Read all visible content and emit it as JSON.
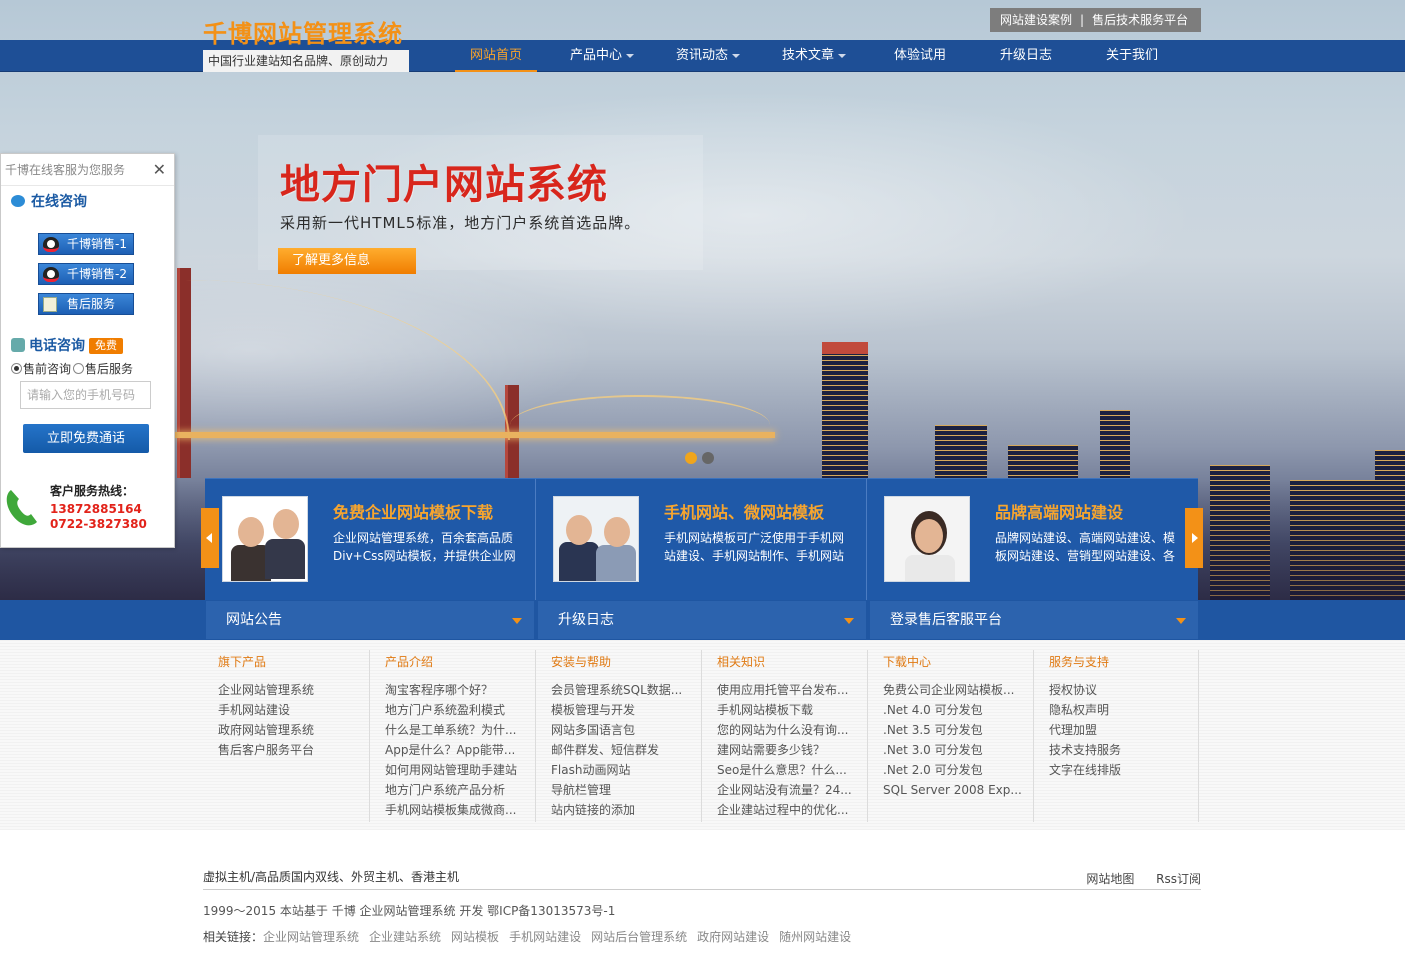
{
  "header": {
    "logo_title": "千博网站管理系统",
    "logo_subtitle": "中国行业建站知名品牌、原创动力",
    "top_links": [
      "网站建设案例",
      "售后技术服务平台"
    ],
    "top_sep": "|",
    "menu": [
      {
        "label": "网站首页",
        "active": true,
        "dropdown": false
      },
      {
        "label": "产品中心",
        "active": false,
        "dropdown": true
      },
      {
        "label": "资讯动态",
        "active": false,
        "dropdown": true
      },
      {
        "label": "技术文章",
        "active": false,
        "dropdown": true
      },
      {
        "label": "体验试用",
        "active": false,
        "dropdown": false
      },
      {
        "label": "升级日志",
        "active": false,
        "dropdown": false
      },
      {
        "label": "关于我们",
        "active": false,
        "dropdown": false
      }
    ]
  },
  "banner": {
    "title": "地方门户网站系统",
    "subtitle": "采用新一代HTML5标准，地方门户系统首选品牌。",
    "button": "了解更多信息",
    "slide_count": 2,
    "active_slide": 1
  },
  "features": [
    {
      "title": "免费企业网站模板下载",
      "desc": "企业网站管理系统，百余套高品质Div+Css网站模板，并提供企业网"
    },
    {
      "title": "手机网站、微网站模板",
      "desc": "手机网站模板可广泛使用于手机网站建设、手机网站制作、手机网站"
    },
    {
      "title": "品牌高端网站建设",
      "desc": "品牌网站建设、高端网站建设、模板网站建设、营销型网站建设、各"
    }
  ],
  "tabs": [
    "网站公告",
    "升级日志",
    "登录售后客服平台"
  ],
  "columns": [
    {
      "title": "旗下产品",
      "items": [
        "企业网站管理系统",
        "手机网站建设",
        "政府网站管理系统",
        "售后客户服务平台"
      ]
    },
    {
      "title": "产品介绍",
      "items": [
        "淘宝客程序哪个好？",
        "地方门户系统盈利模式",
        "什么是工单系统？为什...",
        "App是什么？App能带...",
        "如何用网站管理助手建站",
        "地方门户系统产品分析",
        "手机网站模板集成微商..."
      ]
    },
    {
      "title": "安装与帮助",
      "items": [
        "会员管理系统SQL数据...",
        "模板管理与开发",
        "网站多国语言包",
        "邮件群发、短信群发",
        "Flash动画网站",
        "导航栏管理",
        "站内链接的添加"
      ]
    },
    {
      "title": "相关知识",
      "items": [
        "使用应用托管平台发布...",
        "手机网站模板下载",
        "您的网站为什么没有询...",
        "建网站需要多少钱？",
        "Seo是什么意思？什么...",
        "企业网站没有流量？24...",
        "企业建站过程中的优化..."
      ]
    },
    {
      "title": "下载中心",
      "items": [
        "免费公司企业网站模板...",
        ".Net 4.0 可分发包",
        ".Net 3.5 可分发包",
        ".Net 3.0 可分发包",
        ".Net 2.0 可分发包",
        "SQL Server 2008 Exp..."
      ]
    },
    {
      "title": "服务与支持",
      "items": [
        "授权协议",
        "隐私权声明",
        "代理加盟",
        "技术支持服务",
        "文字在线排版"
      ]
    }
  ],
  "footer": {
    "hosting": "虚拟主机/高品质国内双线、外贸主机、香港主机",
    "sitemap": "网站地图",
    "rss": "Rss订阅",
    "copyright": "1999～2015 本站基于 千博 企业网站管理系统 开发 鄂ICP备13013573号-1",
    "related_label": "相关链接：",
    "related_links": [
      "企业网站管理系统",
      "企业建站系统",
      "网站模板",
      "手机网站建设",
      "网站后台管理系统",
      "政府网站建设",
      "随州网站建设"
    ]
  },
  "service_panel": {
    "header": "千博在线客服为您服务",
    "close": "✕",
    "online_title": "在线咨询",
    "qq_buttons": [
      "千博销售-1",
      "千博销售-2"
    ],
    "aftersale_button": "售后服务",
    "phone_title": "电话咨询",
    "free_badge": "免费",
    "radio_options": [
      "售前咨询",
      "售后服务"
    ],
    "phone_placeholder": "请输入您的手机号码",
    "call_button": "立即免费通话",
    "hotline_label": "客户服务热线：",
    "hotline_numbers": [
      "13872885164",
      "0722-3827380"
    ]
  },
  "colors": {
    "brand_blue": "#1e4f96",
    "accent_orange": "#f39117",
    "banner_red": "#d8261c"
  }
}
